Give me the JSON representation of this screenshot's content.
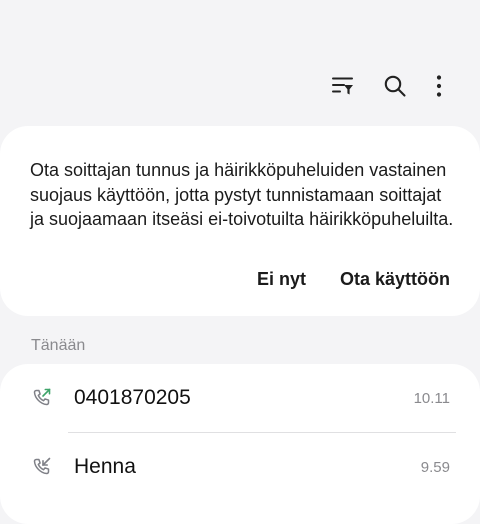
{
  "toolbar": {
    "filter_icon": "filter-list-icon",
    "search_icon": "search-icon",
    "more_icon": "more-vertical-icon"
  },
  "banner": {
    "message": "Ota soittajan tunnus ja häirikköpuheluiden vastainen suojaus käyttöön, jotta pystyt tunnistamaan soittajat ja suojaamaan itseäsi ei-toivotuilta häirikköpuheluilta.",
    "dismiss_label": "Ei nyt",
    "enable_label": "Ota käyttöön"
  },
  "section": {
    "title": "Tänään"
  },
  "calls": [
    {
      "name": "0401870205",
      "time": "10.11",
      "type": "outgoing",
      "icon": "outgoing-call-icon",
      "icon_color": "#3fa46a"
    },
    {
      "name": "Henna",
      "time": "9.59",
      "type": "incoming",
      "icon": "incoming-call-icon",
      "icon_color": "#7f8087"
    }
  ]
}
